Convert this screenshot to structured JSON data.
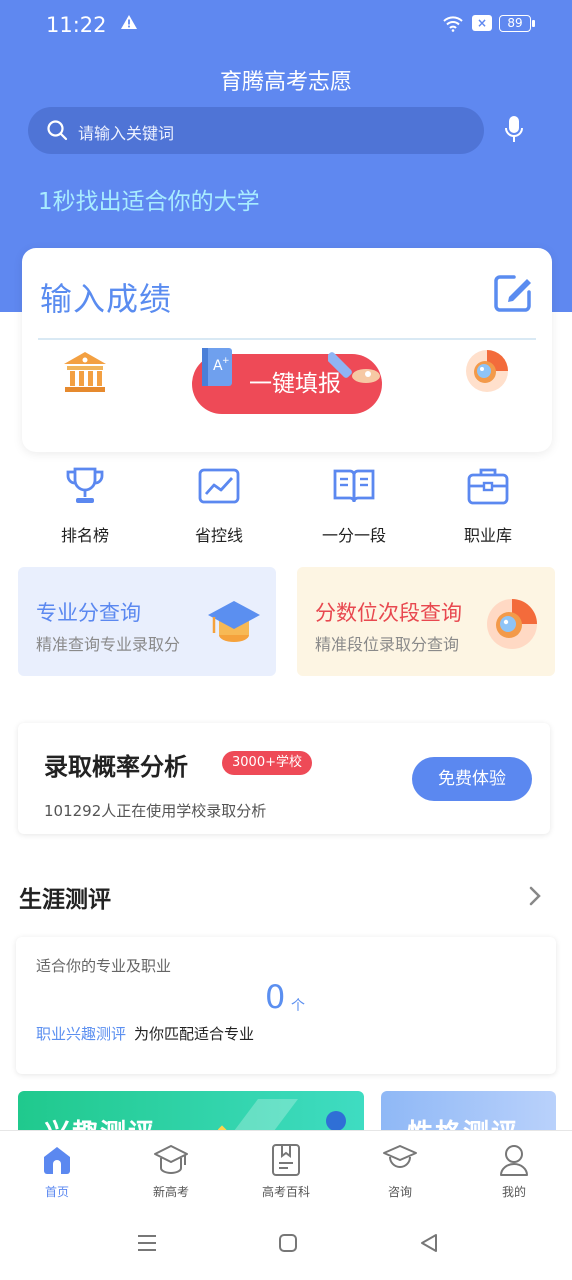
{
  "status_bar": {
    "time": "11:22",
    "battery": "89"
  },
  "header": {
    "title": "育腾高考志愿",
    "search_placeholder": "请输入关键词",
    "slogan": "1秒找出适合你的大学"
  },
  "score_card": {
    "title": "输入成绩",
    "fill_button": "一键填报"
  },
  "quick_links": [
    {
      "label": "排名榜",
      "icon": "trophy-icon"
    },
    {
      "label": "省控线",
      "icon": "chart-line-icon"
    },
    {
      "label": "一分一段",
      "icon": "book-icon"
    },
    {
      "label": "职业库",
      "icon": "briefcase-icon"
    }
  ],
  "promo_cards": [
    {
      "title": "专业分查询",
      "subtitle": "精准查询专业录取分",
      "icon": "graduation-cap-icon"
    },
    {
      "title": "分数位次段查询",
      "subtitle": "精准段位录取分查询",
      "icon": "magnifier-icon"
    }
  ],
  "admission_rate": {
    "title": "录取概率分析",
    "badge": "3000+学校",
    "subtitle": "101292人正在使用学校录取分析",
    "button": "免费体验"
  },
  "career": {
    "section_title": "生涯测评",
    "card_label": "适合你的专业及职业",
    "count": "0",
    "count_unit": "个",
    "link": "职业兴趣测评",
    "link_suffix": "为你匹配适合专业"
  },
  "tests": [
    {
      "title": "兴趣测评"
    },
    {
      "title": "性格测评"
    }
  ],
  "tab_bar": [
    {
      "label": "首页",
      "icon": "home-icon",
      "active": true
    },
    {
      "label": "新高考",
      "icon": "mortarboard-icon",
      "active": false
    },
    {
      "label": "高考百科",
      "icon": "bookmark-icon",
      "active": false
    },
    {
      "label": "咨询",
      "icon": "consult-icon",
      "active": false
    },
    {
      "label": "我的",
      "icon": "user-icon",
      "active": false
    }
  ],
  "colors": {
    "primary": "#5f88f0",
    "accent_red": "#ee4a57",
    "slogan": "#a8ecff"
  }
}
